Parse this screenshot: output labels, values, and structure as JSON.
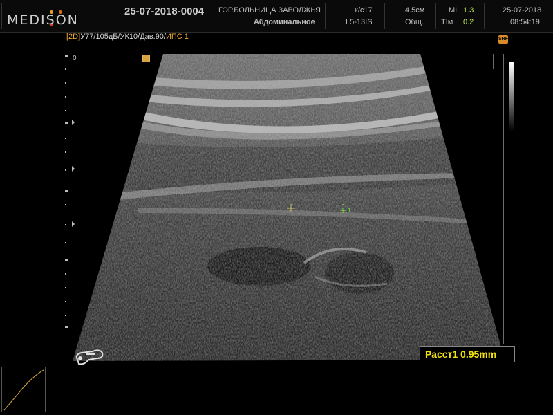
{
  "header": {
    "brand": "MEDISON",
    "brand_dot_colors": [
      "#e3a123",
      "#e06a1e",
      "#d23a2c"
    ],
    "patient_id": "25-07-2018-0004",
    "hospital": "ГОР.БОЛЬНИЦА ЗАВОЛЖЬЯ",
    "exam_type": "Абдоминальное",
    "preset": "к/с17",
    "probe": "L5-13IS",
    "depth": "4.5см",
    "display_mode": "Общ.",
    "mi_label": "MI",
    "mi_value": "1.3",
    "tim_label": "TIм",
    "tim_value": "0.2",
    "date": "25-07-2018",
    "time": "08:54:19"
  },
  "imaging": {
    "mode_tag": "[2D]",
    "params": "У77/105дБ/УК10/Дав.90/",
    "params_end": "ИПС 1",
    "depth_zero": "0",
    "srf_badge": "SRF",
    "caliper_label": "1"
  },
  "measurement": {
    "label": "Расст1 0.95mm",
    "value_mm": 0.95
  },
  "colors": {
    "accent_orange": "#e7a53a",
    "measurement_yellow": "#f2e20a",
    "caliper_green": "#7de04a"
  },
  "icons": [
    "medison-logo",
    "focus-marker-icon",
    "srf-icon",
    "probe-orientation-icon",
    "caliper-cross-icon",
    "grayscale-bar"
  ]
}
